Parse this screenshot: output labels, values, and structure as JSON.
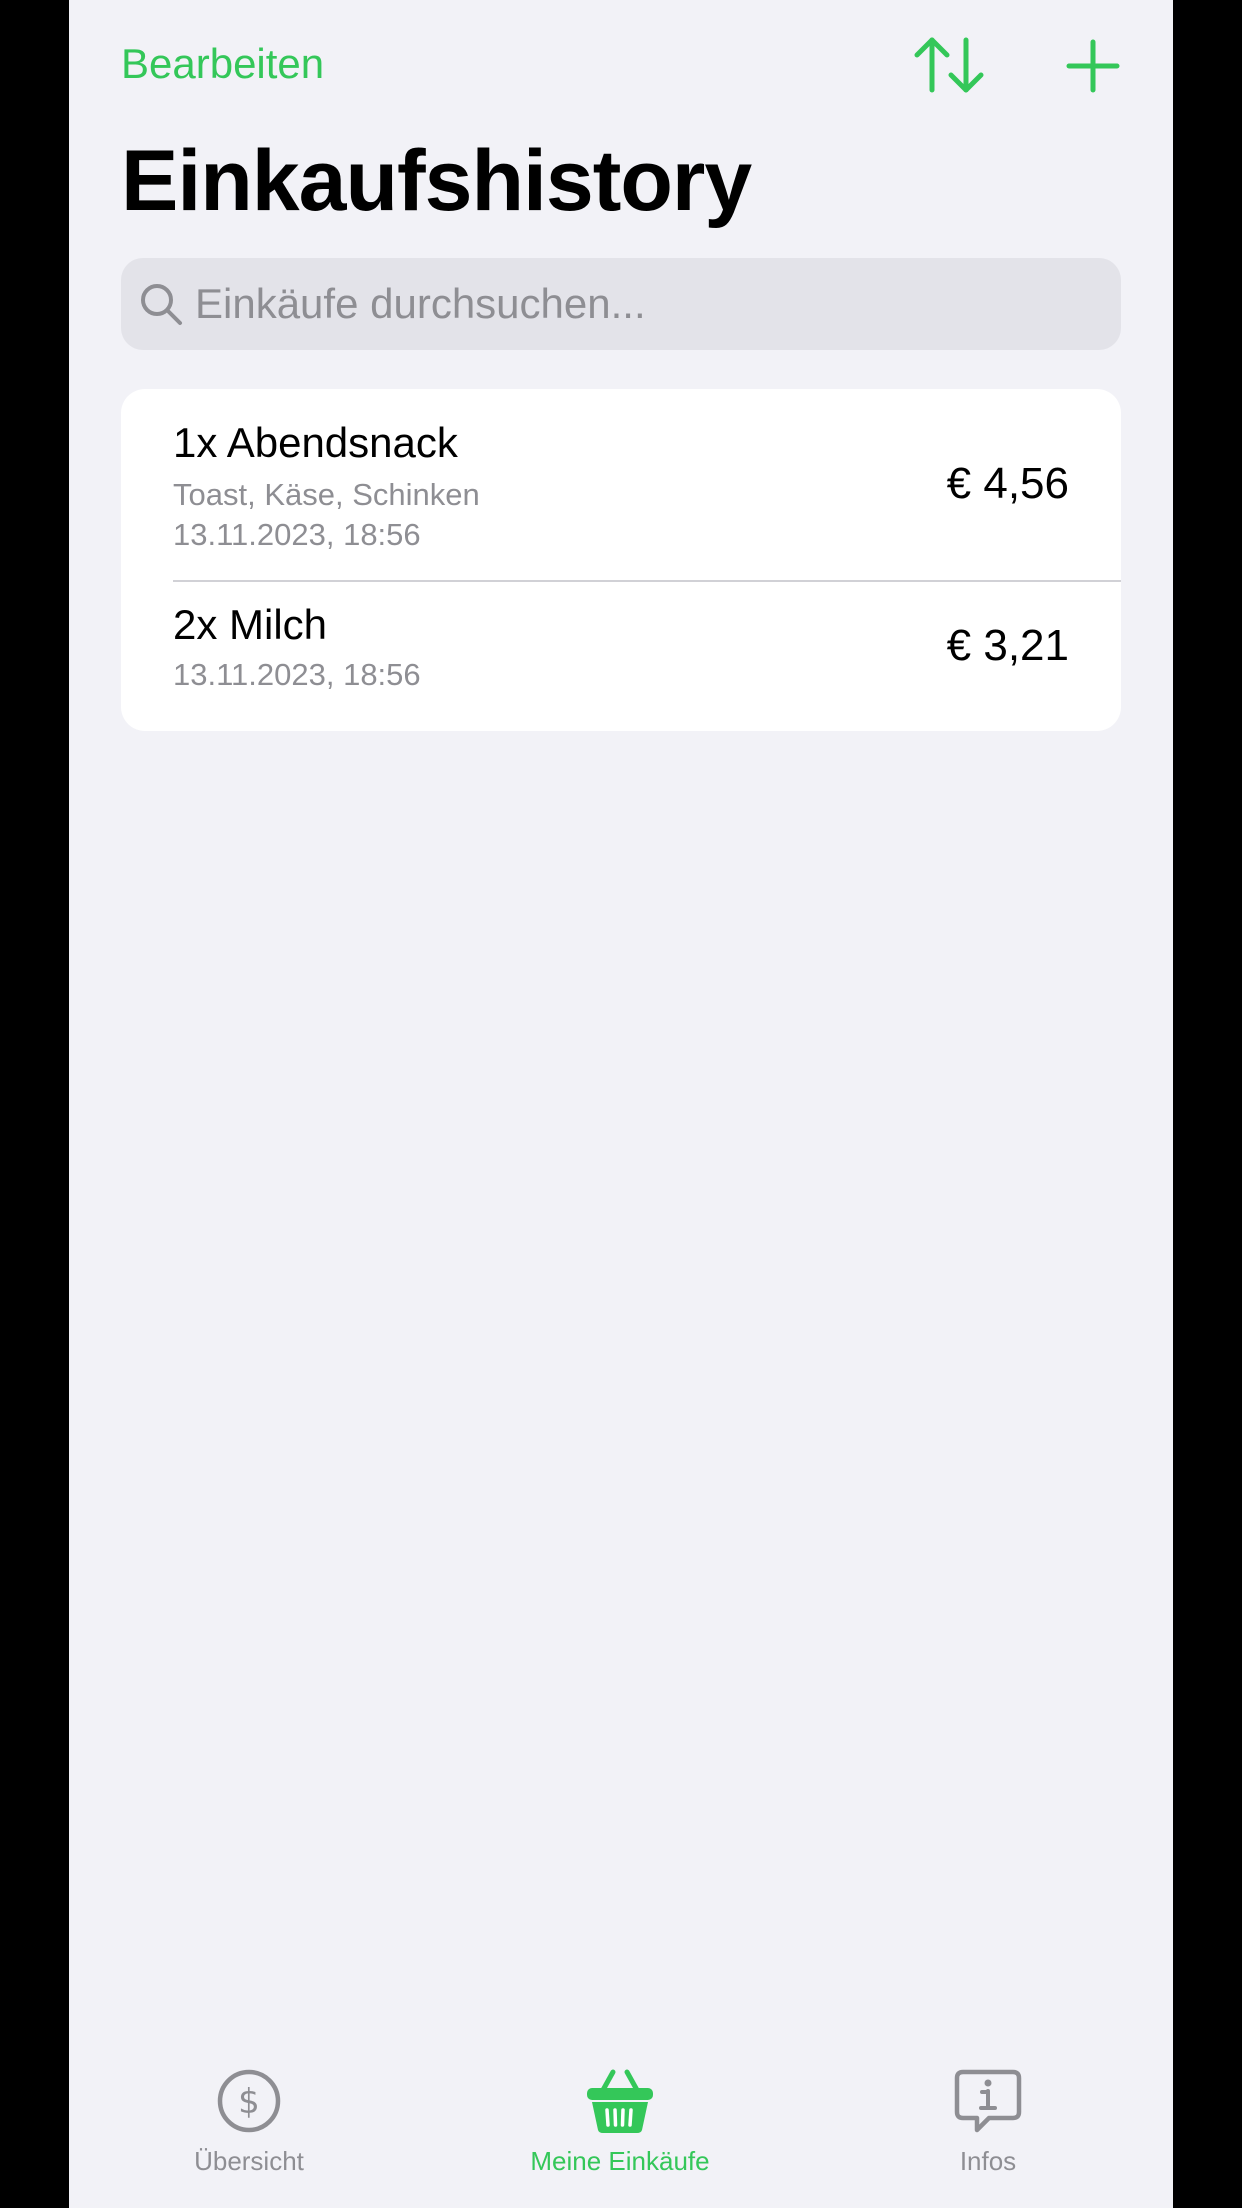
{
  "nav": {
    "edit_label": "Bearbeiten",
    "sort_icon": "arrow-up-arrow-down-icon",
    "add_icon": "plus-icon"
  },
  "page_title": "Einkaufshistory",
  "search": {
    "placeholder": "Einkäufe durchsuchen...",
    "value": "",
    "icon": "magnifying-glass-icon"
  },
  "purchases": [
    {
      "title": "1x Abendsnack",
      "items": "Toast, Käse, Schinken",
      "date": "13.11.2023, 18:56",
      "price": "€ 4,56"
    },
    {
      "title": "2x Milch",
      "date": "13.11.2023, 18:56",
      "price": "€ 3,21"
    }
  ],
  "tabbar": {
    "tabs": [
      {
        "label": "Übersicht",
        "icon": "dollar-circle-icon",
        "active": false
      },
      {
        "label": "Meine Einkäufe",
        "icon": "basket-icon",
        "active": true
      },
      {
        "label": "Infos",
        "icon": "info-bubble-icon",
        "active": false
      }
    ]
  },
  "colors": {
    "accent": "#34c759",
    "background": "#f2f2f7",
    "secondary_text": "#8e8e93",
    "search_fill": "#e3e3e9"
  }
}
